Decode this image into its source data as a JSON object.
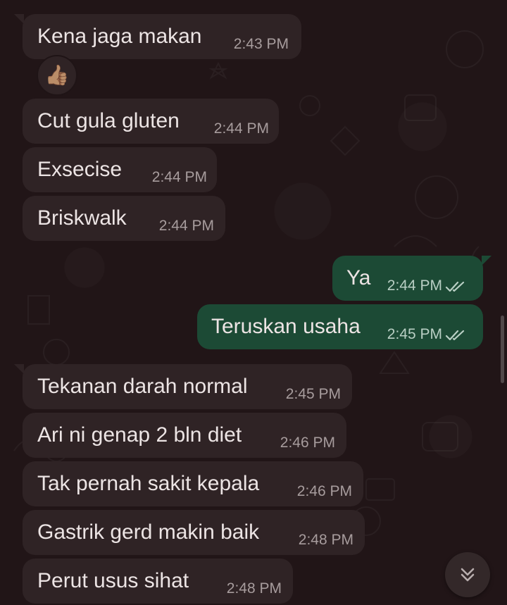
{
  "colors": {
    "incoming_bubble": "#2f2325",
    "outgoing_bubble": "#1c4a35",
    "background": "#211517",
    "read_ticks": "#b9cfc4"
  },
  "messages": [
    {
      "direction": "incoming",
      "text": "Kena jaga makan",
      "time": "2:43 PM",
      "reaction": "👍🏽"
    },
    {
      "direction": "incoming",
      "text": "Cut gula gluten",
      "time": "2:44 PM"
    },
    {
      "direction": "incoming",
      "text": "Exsecise",
      "time": "2:44 PM"
    },
    {
      "direction": "incoming",
      "text": "Briskwalk",
      "time": "2:44 PM"
    },
    {
      "direction": "outgoing",
      "text": "Ya",
      "time": "2:44 PM",
      "status": "read"
    },
    {
      "direction": "outgoing",
      "text": "Teruskan usaha",
      "time": "2:45 PM",
      "status": "read"
    },
    {
      "direction": "incoming",
      "text": "Tekanan darah normal",
      "time": "2:45 PM"
    },
    {
      "direction": "incoming",
      "text": "Ari ni genap 2 bln diet",
      "time": "2:46 PM"
    },
    {
      "direction": "incoming",
      "text": "Tak pernah sakit kepala",
      "time": "2:46 PM"
    },
    {
      "direction": "incoming",
      "text": "Gastrik gerd makin baik",
      "time": "2:48 PM"
    },
    {
      "direction": "incoming",
      "text": "Perut usus sihat",
      "time": "2:48 PM"
    }
  ],
  "icons": {
    "read_receipt": "double-check-icon",
    "scroll_down": "chevron-double-down-icon"
  }
}
